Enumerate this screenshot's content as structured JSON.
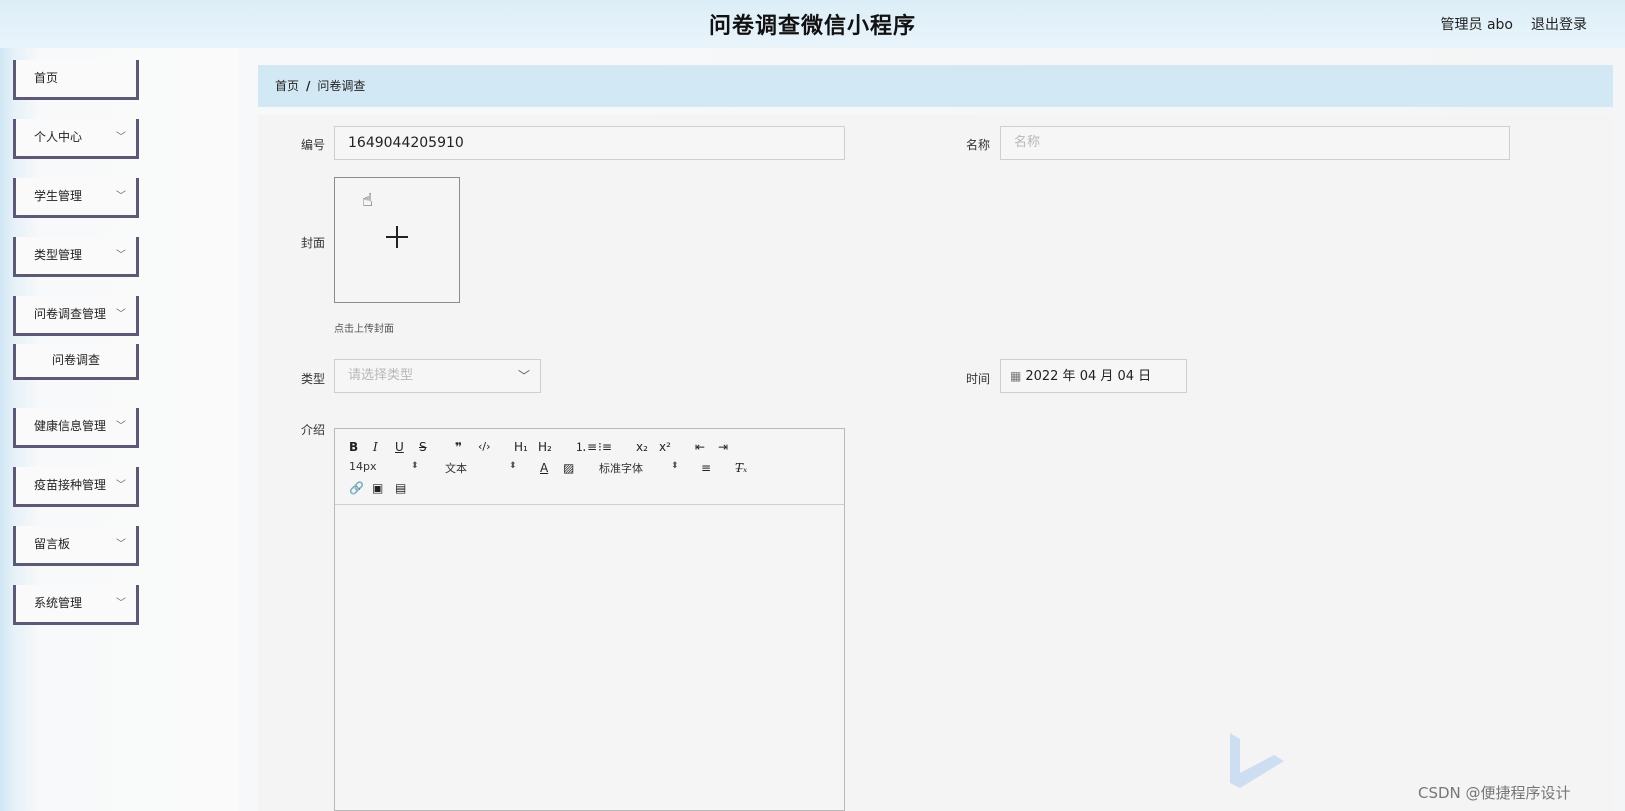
{
  "header": {
    "title": "问卷调查微信小程序",
    "user": "管理员 abo",
    "logout": "退出登录"
  },
  "sidebar": {
    "items": [
      {
        "label": "首页",
        "has_chevron": false
      },
      {
        "label": "个人中心",
        "has_chevron": true
      },
      {
        "label": "学生管理",
        "has_chevron": true
      },
      {
        "label": "类型管理",
        "has_chevron": true
      },
      {
        "label": "问卷调查管理",
        "has_chevron": true
      },
      {
        "label": "健康信息管理",
        "has_chevron": true
      },
      {
        "label": "疫苗接种管理",
        "has_chevron": true
      },
      {
        "label": "留言板",
        "has_chevron": true
      },
      {
        "label": "系统管理",
        "has_chevron": true
      }
    ],
    "sub_item": "问卷调查"
  },
  "breadcrumb": {
    "home": "首页",
    "separator": "/",
    "current": "问卷调查"
  },
  "form": {
    "number": {
      "label": "编号",
      "value": "1649044205910"
    },
    "name": {
      "label": "名称",
      "placeholder": "名称"
    },
    "cover": {
      "label": "封面",
      "hint": "点击上传封面"
    },
    "type": {
      "label": "类型",
      "placeholder": "请选择类型"
    },
    "time": {
      "label": "时间",
      "value": "2022 年 04 月 04 日"
    },
    "intro": {
      "label": "介绍"
    }
  },
  "editor": {
    "font_size": "14px",
    "header_select": "文本",
    "font_family": "标准字体"
  },
  "watermark": "CSDN @便捷程序设计",
  "colors": {
    "header_bg": "#dceef8",
    "breadcrumb_bg": "#d3e8f5",
    "nav_border": "#5c5876",
    "panel_bg": "#f4f4f4"
  },
  "icons": [
    "plus-icon",
    "hand-cursor-icon",
    "calendar-icon",
    "chevron-down-icon",
    "link-icon",
    "image-icon",
    "video-icon"
  ]
}
